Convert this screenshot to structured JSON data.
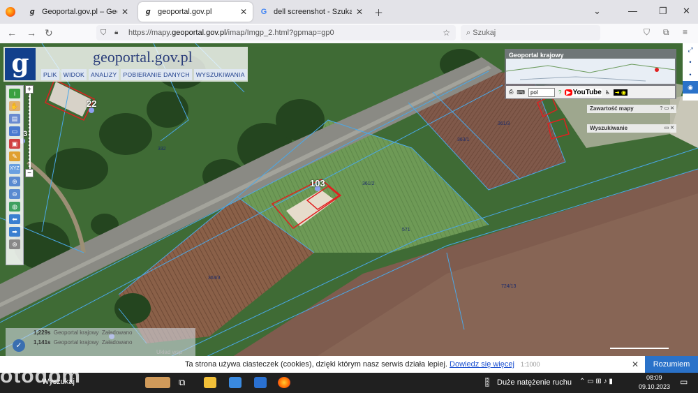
{
  "browser": {
    "tabs": [
      {
        "label": "Geoportal.gov.pl – Geoportal Inf",
        "active": false
      },
      {
        "label": "geoportal.gov.pl",
        "active": true
      },
      {
        "label": "dell screenshot - Szukaj w Goog",
        "active": false
      }
    ],
    "url_prefix": "https://mapy.",
    "url_domain": "geoportal.gov.pl",
    "url_rest": "/imap/Imgp_2.html?gpmap=gp0",
    "search_placeholder": "Szukaj"
  },
  "geoportal": {
    "logo_letter": "g",
    "title": "geoportal.gov.pl",
    "menu": [
      "PLIK",
      "WIDOK",
      "ANALIZY",
      "POBIERANIE DANYCH",
      "WYSZUKIWANIA"
    ]
  },
  "map": {
    "building_numbers": [
      "22",
      "103"
    ],
    "plot_labels": [
      "332",
      "361/3",
      "363/1",
      "361/2",
      "571",
      "363/3",
      "724/13",
      "3"
    ],
    "scale_label": "1:1000"
  },
  "panels": {
    "national_title": "Geoportal krajowy",
    "language": "pol",
    "youtube_label": "YouTube",
    "map_contents": "Zawartość mapy",
    "search": "Wyszukiwanie"
  },
  "status": {
    "rows": [
      {
        "time": "1,229s",
        "source": "Geoportal krajowy",
        "state": "Załadowano"
      },
      {
        "time": "1,141s",
        "source": "Geoportal krajowy",
        "state": "Załadowano"
      }
    ],
    "coord_label": "Układ wsp"
  },
  "cookie": {
    "text": "Ta strona używa ciasteczek (cookies), dzięki którym nasz serwis działa lepiej.",
    "link": "Dowiedz się więcej",
    "accept": "Rozumiem",
    "close": "✕"
  },
  "taskbar": {
    "weather": "Duże natężenie ruchu",
    "time": "08:09",
    "date": "09.10.2023",
    "watermark": "otodom",
    "user_label": "Wyszukaj"
  },
  "colors": {
    "accent": "#2a72c9",
    "plot_line": "#4aa8e8",
    "building_outline": "#e02020",
    "logo_bg": "#12408c"
  }
}
